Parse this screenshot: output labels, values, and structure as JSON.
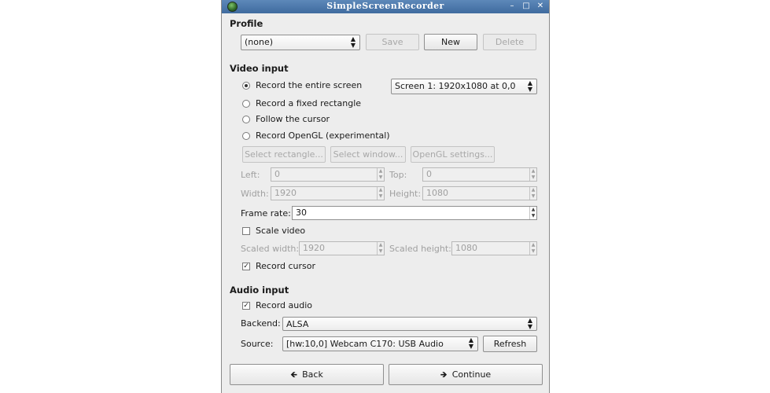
{
  "window": {
    "title": "SimpleScreenRecorder"
  },
  "profile": {
    "heading": "Profile",
    "selected": "(none)",
    "save_label": "Save",
    "new_label": "New",
    "delete_label": "Delete"
  },
  "video": {
    "heading": "Video input",
    "options": [
      {
        "label": "Record the entire screen",
        "checked": true
      },
      {
        "label": "Record a fixed rectangle",
        "checked": false
      },
      {
        "label": "Follow the cursor",
        "checked": false
      },
      {
        "label": "Record OpenGL (experimental)",
        "checked": false
      }
    ],
    "screen_select": "Screen 1: 1920x1080 at 0,0",
    "select_rectangle": "Select rectangle...",
    "select_window": "Select window...",
    "opengl_settings": "OpenGL settings...",
    "left_label": "Left:",
    "left_value": "0",
    "top_label": "Top:",
    "top_value": "0",
    "width_label": "Width:",
    "width_value": "1920",
    "height_label": "Height:",
    "height_value": "1080",
    "framerate_label": "Frame rate:",
    "framerate_value": "30",
    "scale_label": "Scale video",
    "scale_checked": false,
    "scaled_width_label": "Scaled width:",
    "scaled_width_value": "1920",
    "scaled_height_label": "Scaled height:",
    "scaled_height_value": "1080",
    "record_cursor_label": "Record cursor",
    "record_cursor_checked": true
  },
  "audio": {
    "heading": "Audio input",
    "record_audio_label": "Record audio",
    "record_audio_checked": true,
    "backend_label": "Backend:",
    "backend_value": "ALSA",
    "source_label": "Source:",
    "source_value": "[hw:10,0] Webcam C170: USB Audio",
    "refresh_label": "Refresh"
  },
  "footer": {
    "back_label": "Back",
    "continue_label": "Continue"
  }
}
